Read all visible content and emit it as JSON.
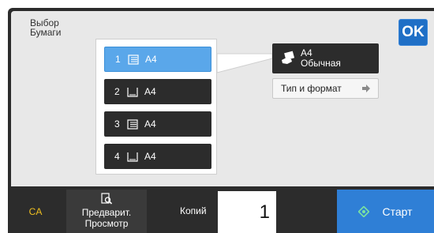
{
  "screen": {
    "title_line1": "Выбор",
    "title_line2": "Бумаги",
    "ok_label": "OK"
  },
  "trays": [
    {
      "number": "1",
      "size": "A4",
      "icon": "tray-stack-icon",
      "selected": true
    },
    {
      "number": "2",
      "size": "A4",
      "icon": "tray-empty-icon",
      "selected": false
    },
    {
      "number": "3",
      "size": "A4",
      "icon": "tray-stack-icon",
      "selected": false
    },
    {
      "number": "4",
      "size": "A4",
      "icon": "tray-empty-icon",
      "selected": false
    }
  ],
  "paper_info": {
    "size": "A4",
    "type": "Обычная",
    "icon": "paper-hand-icon"
  },
  "type_button": {
    "label": "Тип и формат",
    "icon": "arrow-right-icon"
  },
  "bottom": {
    "ca_label": "CA",
    "preview_line1": "Предварит.",
    "preview_line2": "Просмотр",
    "preview_icon": "magnifier-doc-icon",
    "copies_label": "Копий",
    "copies_value": "1",
    "start_label": "Старт",
    "start_icon": "diamond-start-icon"
  },
  "colors": {
    "accent": "#2f7fd6",
    "selected_tray": "#5aa7ea",
    "dark_button": "#2c2c2c",
    "ca_text": "#f0c020"
  }
}
